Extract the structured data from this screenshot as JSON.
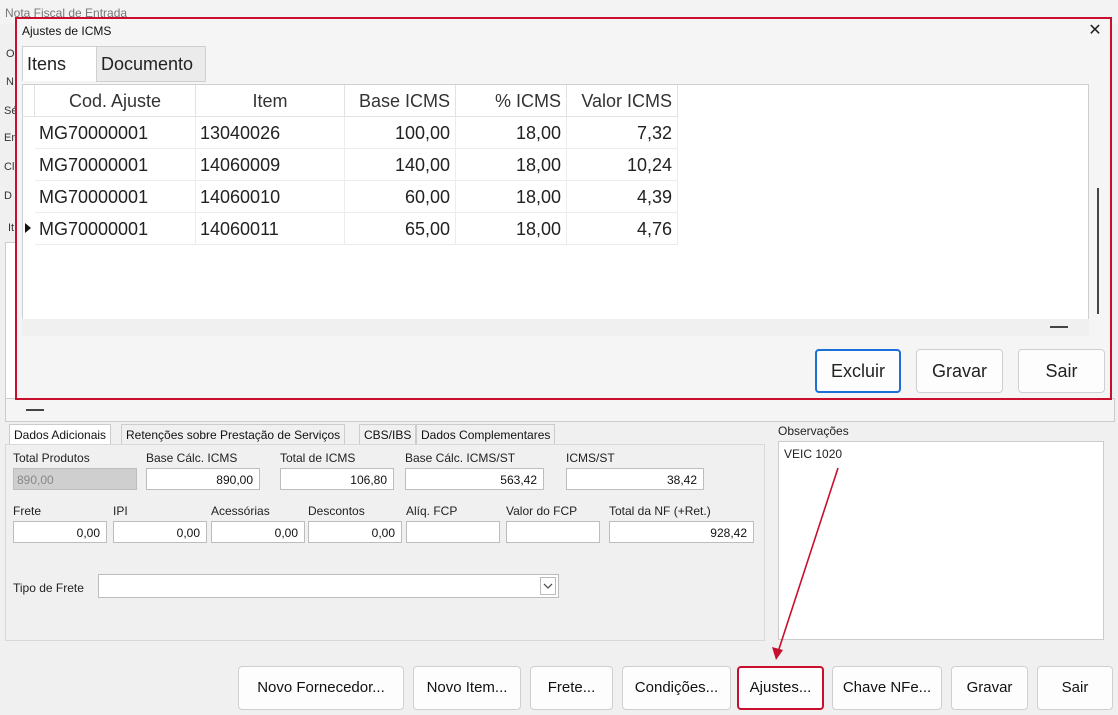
{
  "main": {
    "title": "Nota Fiscal de Entrada",
    "left_fragments": [
      "O",
      "N",
      "Sé",
      "En",
      "Cl",
      "D",
      "It"
    ],
    "tabs": [
      "Dados Adicionais",
      "Retenções sobre Prestação de Serviços",
      "CBS/IBS",
      "Dados Complementares"
    ],
    "fields_row1": [
      {
        "label": "Total Produtos",
        "value": "890,00"
      },
      {
        "label": "Base Cálc. ICMS",
        "value": "890,00"
      },
      {
        "label": "Total de ICMS",
        "value": "106,80"
      },
      {
        "label": "Base Cálc. ICMS/ST",
        "value": "563,42"
      },
      {
        "label": "ICMS/ST",
        "value": "38,42"
      }
    ],
    "fields_row2": [
      {
        "label": "Frete",
        "value": "0,00"
      },
      {
        "label": "IPI",
        "value": "0,00"
      },
      {
        "label": "Acessórias",
        "value": "0,00"
      },
      {
        "label": "Descontos",
        "value": "0,00"
      },
      {
        "label": "Alíq. FCP",
        "value": ""
      },
      {
        "label": "Valor do FCP",
        "value": ""
      },
      {
        "label": "Total da NF (+Ret.)",
        "value": "928,42"
      }
    ],
    "tipo_frete_label": "Tipo de Frete",
    "tipo_frete_value": "",
    "observacoes_label": "Observações",
    "observacoes_text": "VEIC 1020",
    "buttons": [
      "Novo Fornecedor...",
      "Novo Item...",
      "Frete...",
      "Condições...",
      "Ajustes...",
      "Chave NFe...",
      "Gravar",
      "Sair"
    ]
  },
  "dialog": {
    "title": "Ajustes de ICMS",
    "close_glyph": "✕",
    "tabs": [
      "Itens",
      "Documento"
    ],
    "columns": [
      "Cod. Ajuste",
      "Item",
      "Base ICMS",
      "% ICMS",
      "Valor ICMS"
    ],
    "rows": [
      [
        "MG70000001",
        "13040026",
        "100,00",
        "18,00",
        "7,32"
      ],
      [
        "MG70000001",
        "14060009",
        "140,00",
        "18,00",
        "10,24"
      ],
      [
        "MG70000001",
        "14060010",
        "60,00",
        "18,00",
        "4,39"
      ],
      [
        "MG70000001",
        "14060011",
        "65,00",
        "18,00",
        "4,76"
      ]
    ],
    "current_row": 3,
    "buttons": [
      "Excluir",
      "Gravar",
      "Sair"
    ]
  },
  "colors": {
    "highlight": "#c8102e",
    "focus": "#1a6fd8"
  }
}
